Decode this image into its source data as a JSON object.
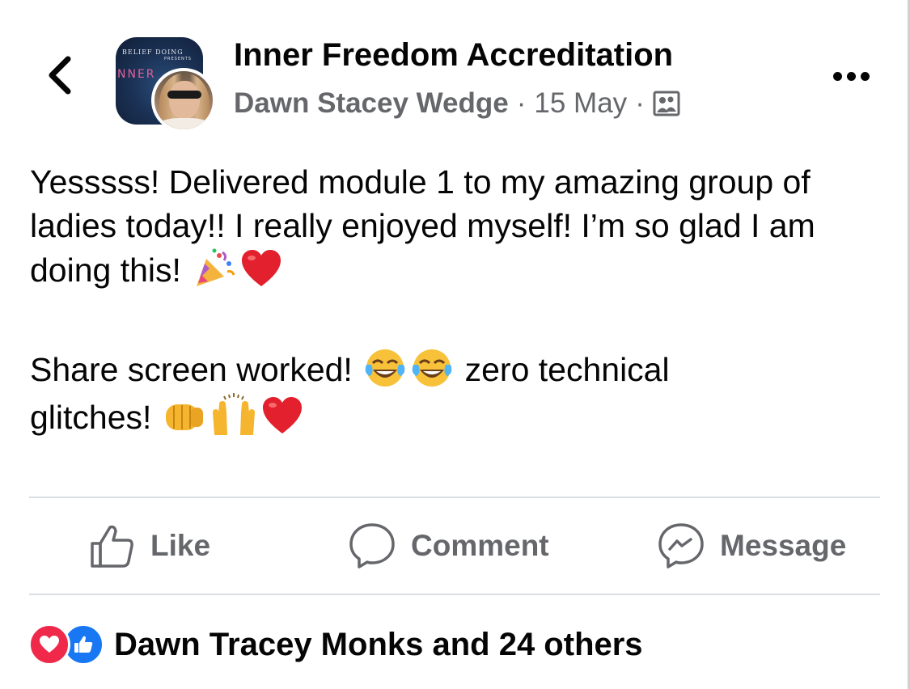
{
  "header": {
    "group_name": "Inner Freedom Accreditation",
    "author": "Dawn Stacey Wedge",
    "separator": "·",
    "date": "15 May",
    "avatar_banner_line1": "BELIEF DOING",
    "avatar_banner_line2": "PRESENTS",
    "avatar_banner_big": "NNER"
  },
  "post": {
    "paragraph1": "Yesssss! Delivered module 1 to my amazing group of ladies today!! I really enjoyed myself! I’m so glad I am doing this!",
    "paragraph2_start": "Share screen worked!",
    "paragraph2_mid": "zero technical",
    "paragraph2_end": "glitches!",
    "emojis": [
      "party-popper",
      "red-heart",
      "tears-of-joy",
      "tears-of-joy",
      "fist-bump",
      "raising-hands",
      "red-heart"
    ]
  },
  "actions": {
    "like": "Like",
    "comment": "Comment",
    "message": "Message"
  },
  "reactions": {
    "text": "Dawn Tracey Monks and 24 others",
    "icons": [
      "love-reaction",
      "like-reaction"
    ]
  },
  "colors": {
    "text": "#050505",
    "secondary": "#65676b",
    "divider": "#dadde1",
    "like_blue": "#1877f2",
    "love_red": "#f02849"
  }
}
